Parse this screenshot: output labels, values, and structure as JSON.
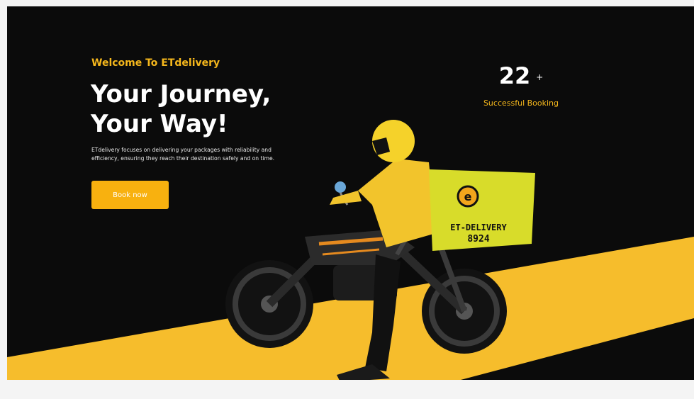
{
  "hero": {
    "eyebrow": "Welcome To ETdelivery",
    "headline_line1": "Your Journey,",
    "headline_line2": "Your Way!",
    "description": "ETdelivery focuses on delivering your packages with reliability and efficiency, ensuring they reach their destination safely and on time.",
    "cta_label": "Book now"
  },
  "stat": {
    "value": "22",
    "suffix": "+",
    "label": "Successful Booking"
  },
  "illustration": {
    "box_brand": "ET-DELIVERY",
    "box_number": "8924",
    "box_logo_letter": "e"
  },
  "colors": {
    "accent": "#f8b10f",
    "background": "#0b0b0b",
    "stripe": "#f6bd2c",
    "text": "#ffffff"
  }
}
